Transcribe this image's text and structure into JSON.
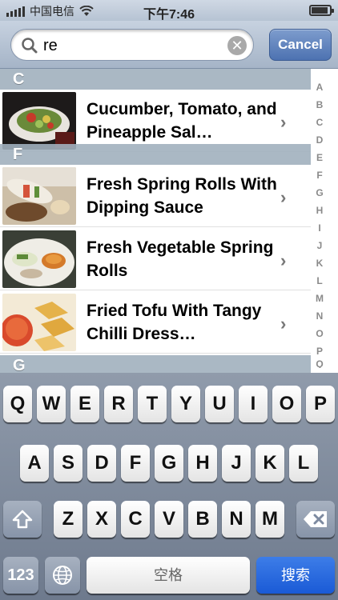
{
  "status": {
    "carrier": "中国电信",
    "time": "下午7:46",
    "signal_bars": 5,
    "wifi_icon": "wifi-icon",
    "battery_icon": "battery-charging-icon"
  },
  "search": {
    "value": "re",
    "icon": "search-icon",
    "clear_icon": "clear-icon",
    "clear_glyph": "✕",
    "cancel_label": "Cancel"
  },
  "list": {
    "sections": [
      {
        "letter": "C"
      },
      {
        "letter": "F"
      },
      {
        "letter": "G"
      }
    ],
    "rows": [
      {
        "title": "Cucumber, Tomato, and Pineapple Sal…",
        "thumb": "cucumber-salad-thumbnail"
      },
      {
        "title": "Fresh Spring Rolls With Dipping Sauce",
        "thumb": "spring-rolls-thumbnail"
      },
      {
        "title": "Fresh Vegetable Spring Rolls",
        "thumb": "vegetable-rolls-thumbnail"
      },
      {
        "title": "Fried Tofu With Tangy Chilli Dress…",
        "thumb": "fried-tofu-thumbnail"
      }
    ],
    "chevron_glyph": "›"
  },
  "index": [
    "A",
    "B",
    "C",
    "D",
    "E",
    "F",
    "G",
    "H",
    "I",
    "J",
    "K",
    "L",
    "M",
    "N",
    "O",
    "P",
    "Q"
  ],
  "keyboard": {
    "row1": [
      "Q",
      "W",
      "E",
      "R",
      "T",
      "Y",
      "U",
      "I",
      "O",
      "P"
    ],
    "row2": [
      "A",
      "S",
      "D",
      "F",
      "G",
      "H",
      "J",
      "K",
      "L"
    ],
    "row3": [
      "Z",
      "X",
      "C",
      "V",
      "B",
      "N",
      "M"
    ],
    "shift_icon": "shift-icon",
    "backspace_icon": "backspace-icon",
    "numbers_label": "123",
    "globe_icon": "globe-icon",
    "space_label": "空格",
    "search_label": "搜索",
    "accent_color": "#1a5ad6"
  }
}
